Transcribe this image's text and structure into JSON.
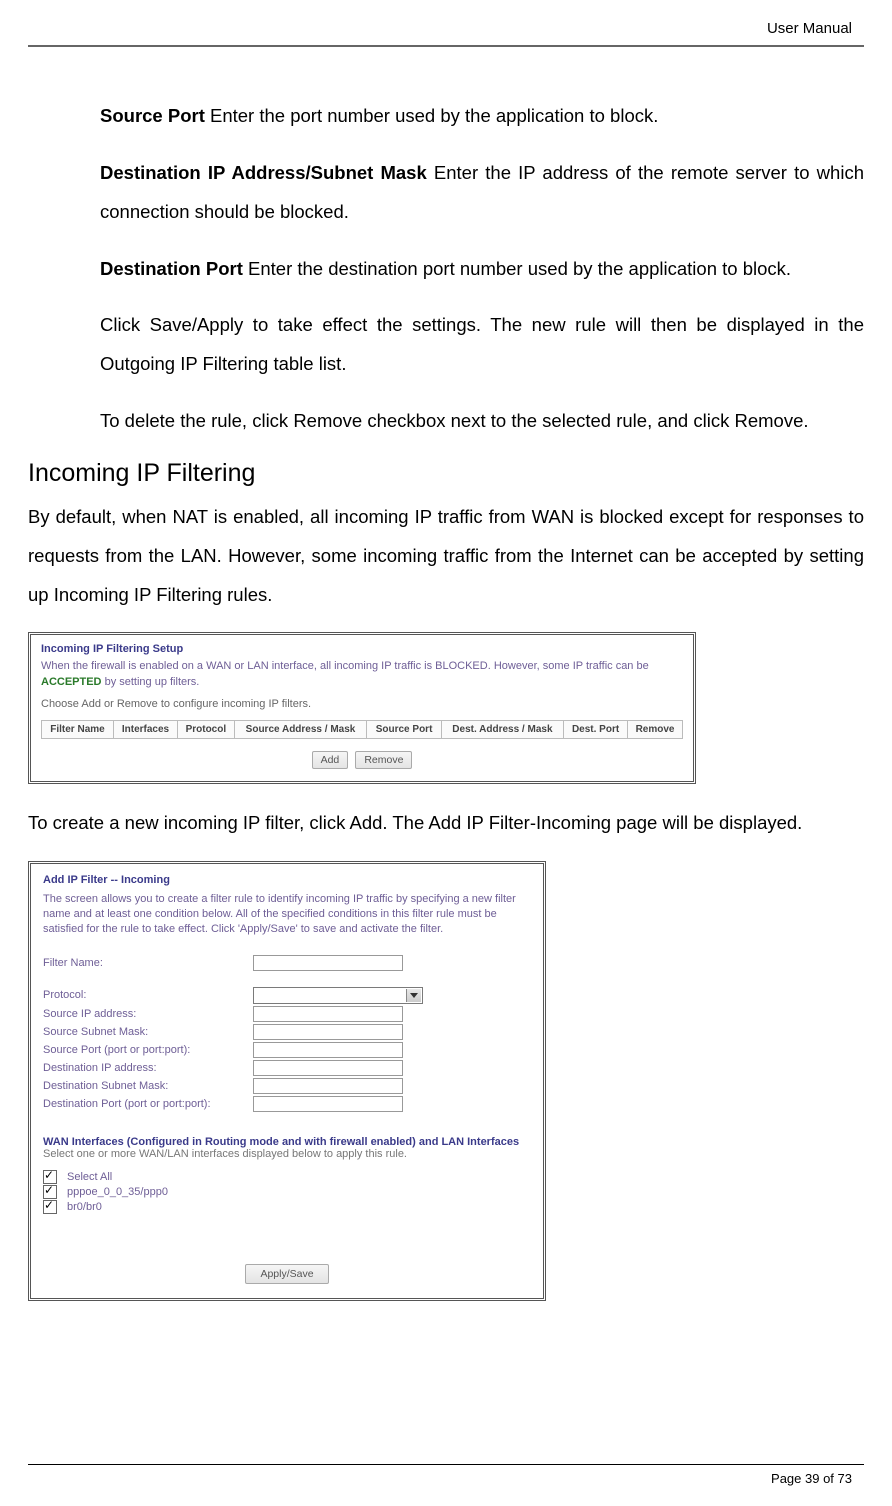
{
  "header": {
    "title": "User Manual"
  },
  "footer": {
    "text": "Page 39 of 73"
  },
  "para": {
    "src_port_label": "Source Port",
    "src_port_rest": " Enter the port number used by the application to block.",
    "dest_ip_label": "Destination IP Address/Subnet Mask",
    "dest_ip_rest": " Enter the IP address of the remote server to which connection should be blocked.",
    "dest_port_label": "Destination Port",
    "dest_port_rest": " Enter the destination port number used by the application to block.",
    "save_apply": "Click Save/Apply to take effect the settings. The new rule will then be displayed in the Outgoing IP Filtering table list.",
    "delete_rule": "To delete the rule, click Remove checkbox next to the selected rule, and click Remove."
  },
  "section_title": "Incoming IP Filtering",
  "intro": "By default, when NAT is enabled, all incoming IP traffic from WAN is blocked except for responses to requests from the LAN. However, some incoming traffic from the Internet can be accepted by setting up Incoming IP Filtering rules.",
  "shot1": {
    "title": "Incoming IP Filtering Setup",
    "desc_pre": "When the firewall is enabled on a WAN or LAN interface, all incoming IP traffic is BLOCKED. However, some IP traffic can be ",
    "accepted": "ACCEPTED",
    "desc_post": " by setting up filters.",
    "desc2": "Choose Add or Remove to configure incoming IP filters.",
    "cols": [
      "Filter Name",
      "Interfaces",
      "Protocol",
      "Source Address / Mask",
      "Source Port",
      "Dest. Address / Mask",
      "Dest. Port",
      "Remove"
    ],
    "btn_add": "Add",
    "btn_remove": "Remove"
  },
  "mid_text": "To create a new incoming IP filter, click Add. The Add IP Filter-Incoming page will be displayed.",
  "shot2": {
    "title": "Add IP Filter -- Incoming",
    "desc": "The screen allows you to create a filter rule to identify incoming IP traffic by specifying a new filter name and at least one condition below. All of the specified conditions in this filter rule must be satisfied for the rule to take effect. Click 'Apply/Save' to save and activate the filter.",
    "fields": {
      "filter_name": "Filter Name:",
      "protocol": "Protocol:",
      "src_ip": "Source IP address:",
      "src_mask": "Source Subnet Mask:",
      "src_port": "Source Port (port or port:port):",
      "dst_ip": "Destination IP address:",
      "dst_mask": "Destination Subnet Mask:",
      "dst_port": "Destination Port (port or port:port):"
    },
    "wan_title": "WAN Interfaces (Configured in Routing mode and with firewall enabled) and LAN Interfaces",
    "wan_desc": "Select one or more WAN/LAN interfaces displayed below to apply this rule.",
    "checkboxes": [
      "Select All",
      "pppoe_0_0_35/ppp0",
      "br0/br0"
    ],
    "apply": "Apply/Save"
  }
}
